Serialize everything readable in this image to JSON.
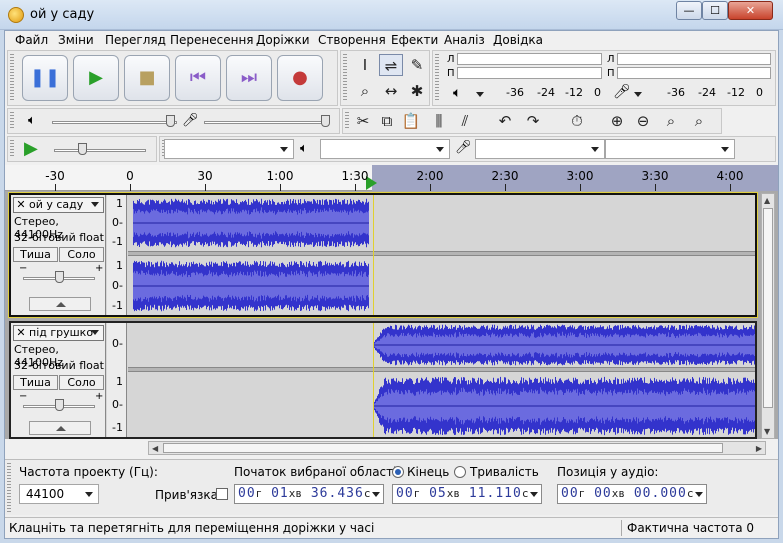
{
  "window": {
    "title": "ой у саду",
    "min_label": "—",
    "max_label": "☐",
    "close_label": "✕"
  },
  "menu": [
    "Файл",
    "Зміни",
    "Перегляд",
    "Перенесення",
    "Доріжки",
    "Створення",
    "Ефекти",
    "Аналіз",
    "Довідка"
  ],
  "transport": {
    "buttons": [
      {
        "name": "pause-button",
        "icon": "pause-icon",
        "glyph": "❚❚",
        "color": "#3a6fd8"
      },
      {
        "name": "play-button",
        "icon": "play-icon",
        "glyph": "▶",
        "color": "#2aa02a"
      },
      {
        "name": "stop-button",
        "icon": "stop-icon",
        "glyph": "■",
        "color": "#b8a060"
      },
      {
        "name": "skip-start-button",
        "icon": "skip-start-icon",
        "glyph": "⏮",
        "color": "#8a5cc8"
      },
      {
        "name": "skip-end-button",
        "icon": "skip-end-icon",
        "glyph": "⏭",
        "color": "#8a5cc8"
      },
      {
        "name": "record-button",
        "icon": "record-icon",
        "glyph": "●",
        "color": "#c43a3a"
      }
    ]
  },
  "tools": [
    {
      "name": "selection-tool",
      "icon": "ibeam-icon",
      "glyph": "I"
    },
    {
      "name": "envelope-tool",
      "icon": "envelope-icon",
      "glyph": "⇌"
    },
    {
      "name": "draw-tool",
      "icon": "pencil-icon",
      "glyph": "✎"
    },
    {
      "name": "zoom-tool",
      "icon": "magnifier-icon",
      "glyph": "⌕"
    },
    {
      "name": "timeshift-tool",
      "icon": "double-arrow-icon",
      "glyph": "↔"
    },
    {
      "name": "multi-tool",
      "icon": "asterisk-icon",
      "glyph": "✱"
    }
  ],
  "meters": {
    "play_l": "Л",
    "play_p": "П",
    "rec_l": "Л",
    "rec_p": "П",
    "ticks": [
      "-36",
      "-24",
      "-12",
      "0"
    ]
  },
  "edit_tools": [
    {
      "name": "cut-button",
      "icon": "scissors-icon",
      "glyph": "✂"
    },
    {
      "name": "copy-button",
      "icon": "copy-icon",
      "glyph": "⧉"
    },
    {
      "name": "paste-button",
      "icon": "paste-icon",
      "glyph": "📋"
    },
    {
      "name": "trim-button",
      "icon": "trim-icon",
      "glyph": "⫼"
    },
    {
      "name": "silence-button",
      "icon": "silence-icon",
      "glyph": "⫽"
    },
    {
      "name": "undo-button",
      "icon": "undo-icon",
      "glyph": "↶"
    },
    {
      "name": "redo-button",
      "icon": "redo-icon",
      "glyph": "↷"
    },
    {
      "name": "sync-lock-button",
      "icon": "timer-icon",
      "glyph": "⏱"
    },
    {
      "name": "zoom-in-button",
      "icon": "zoom-in-icon",
      "glyph": "⊕"
    },
    {
      "name": "zoom-out-button",
      "icon": "zoom-out-icon",
      "glyph": "⊖"
    },
    {
      "name": "fit-selection-button",
      "icon": "fit-selection-icon",
      "glyph": "⌕"
    },
    {
      "name": "fit-project-button",
      "icon": "fit-project-icon",
      "glyph": "⌕"
    }
  ],
  "timeline": {
    "ticks": [
      "-30",
      "0",
      "30",
      "1:00",
      "1:30",
      "2:00",
      "2:30",
      "3:00",
      "3:30",
      "4:00"
    ]
  },
  "tracks": [
    {
      "name": "ой у саду",
      "info1": "Стерео, 44100Hz",
      "info2": "32-бітовий float",
      "mute": "Тиша",
      "solo": "Соло",
      "ruler_top": [
        "1",
        "0-",
        "-1"
      ],
      "ruler_bottom": [
        "1",
        "0-",
        "-1"
      ]
    },
    {
      "name": "під грушко",
      "info1": "Стерео, 44100Hz",
      "info2": "32-бітовий float",
      "mute": "Тиша",
      "solo": "Соло",
      "ruler_top": [
        "0-"
      ],
      "ruler_bottom": [
        "1",
        "0-",
        "-1"
      ]
    }
  ],
  "selection": {
    "rate_label": "Частота проекту (Гц):",
    "rate_value": "44100",
    "snap_label": "Прив'язка",
    "start_label": "Початок вибраної області:",
    "end_label": "Кінець",
    "length_label": "Тривалість",
    "position_label": "Позиція у аудіо:",
    "start_time": {
      "h": "00",
      "m": "01",
      "s": "36.436"
    },
    "end_time": {
      "h": "00",
      "m": "05",
      "s": "11.110"
    },
    "pos_time": {
      "h": "00",
      "m": "00",
      "s": "00.000"
    },
    "unit_h": "г",
    "unit_m": "хв",
    "unit_s": "с"
  },
  "status": {
    "hint": "Клацніть та перетягніть для переміщення доріжки у часі",
    "rate": "Фактична частота 0"
  },
  "colors": {
    "wave": "#3333cc",
    "wave_light": "#6b6bdf",
    "selection": "#9fa4c2",
    "cursor": "#e0d030"
  }
}
